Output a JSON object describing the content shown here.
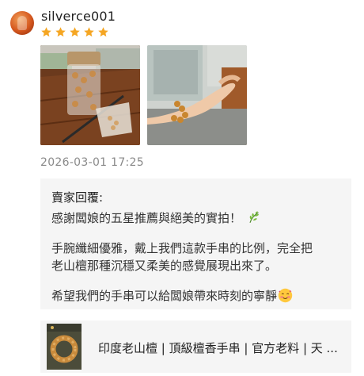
{
  "review": {
    "username": "silverce001",
    "rating": 5,
    "timestamp": "2026-03-01 17:25",
    "photos": [
      "bead-jar-photo",
      "wrist-bracelet-photo"
    ]
  },
  "seller_reply": {
    "title": "賣家回覆:",
    "line1": "感謝闆娘的五星推薦與絕美的實拍！",
    "line2": "手腕纖細優雅，戴上我們這款手串的比例，完全把",
    "line3": "老山檀那種沉穩又柔美的感覺展現出來了。",
    "line4": "希望我們的手串可以給闆娘帶來時刻的寧靜"
  },
  "product": {
    "name": "印度老山檀 | 頂級檀香手串 | 官方老料 | 天然原木色 | 檀香手鍊"
  },
  "colors": {
    "star": "#f5a623",
    "reply_bg": "#f5f5f5",
    "timestamp": "#8a8a8a"
  },
  "icons": [
    "leaf-icon",
    "smiling-face-icon",
    "star-icon"
  ]
}
